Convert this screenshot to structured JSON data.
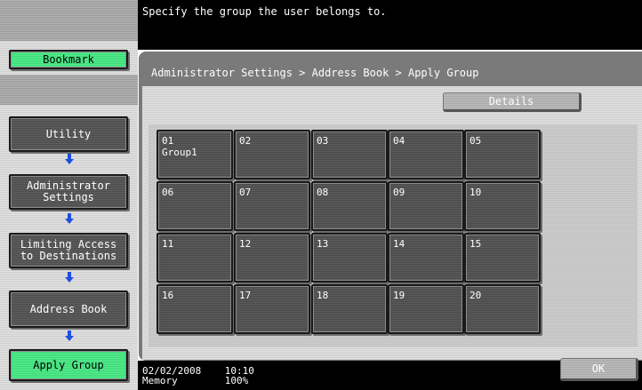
{
  "header": {
    "message": "Specify the group the user belongs to."
  },
  "sidebar": {
    "bookmark_label": "Bookmark",
    "nav": [
      {
        "label": "Utility"
      },
      {
        "label": "Administrator\nSettings"
      },
      {
        "label": "Limiting Access\nto Destinations"
      },
      {
        "label": "Address Book"
      },
      {
        "label": "Apply Group"
      }
    ]
  },
  "main": {
    "breadcrumb": "Administrator Settings > Address Book > Apply Group",
    "details_label": "Details",
    "groups": [
      {
        "number": "01",
        "name": "Group1"
      },
      {
        "number": "02",
        "name": ""
      },
      {
        "number": "03",
        "name": ""
      },
      {
        "number": "04",
        "name": ""
      },
      {
        "number": "05",
        "name": ""
      },
      {
        "number": "06",
        "name": ""
      },
      {
        "number": "07",
        "name": ""
      },
      {
        "number": "08",
        "name": ""
      },
      {
        "number": "09",
        "name": ""
      },
      {
        "number": "10",
        "name": ""
      },
      {
        "number": "11",
        "name": ""
      },
      {
        "number": "12",
        "name": ""
      },
      {
        "number": "13",
        "name": ""
      },
      {
        "number": "14",
        "name": ""
      },
      {
        "number": "15",
        "name": ""
      },
      {
        "number": "16",
        "name": ""
      },
      {
        "number": "17",
        "name": ""
      },
      {
        "number": "18",
        "name": ""
      },
      {
        "number": "19",
        "name": ""
      },
      {
        "number": "20",
        "name": ""
      }
    ]
  },
  "status": {
    "date": "02/02/2008",
    "time": "10:10",
    "memory_label": "Memory",
    "memory_value": "100%"
  },
  "footer": {
    "ok_label": "OK"
  },
  "colors": {
    "accent_green": "#55ec8d",
    "arrow_blue": "#1f4fe0"
  }
}
